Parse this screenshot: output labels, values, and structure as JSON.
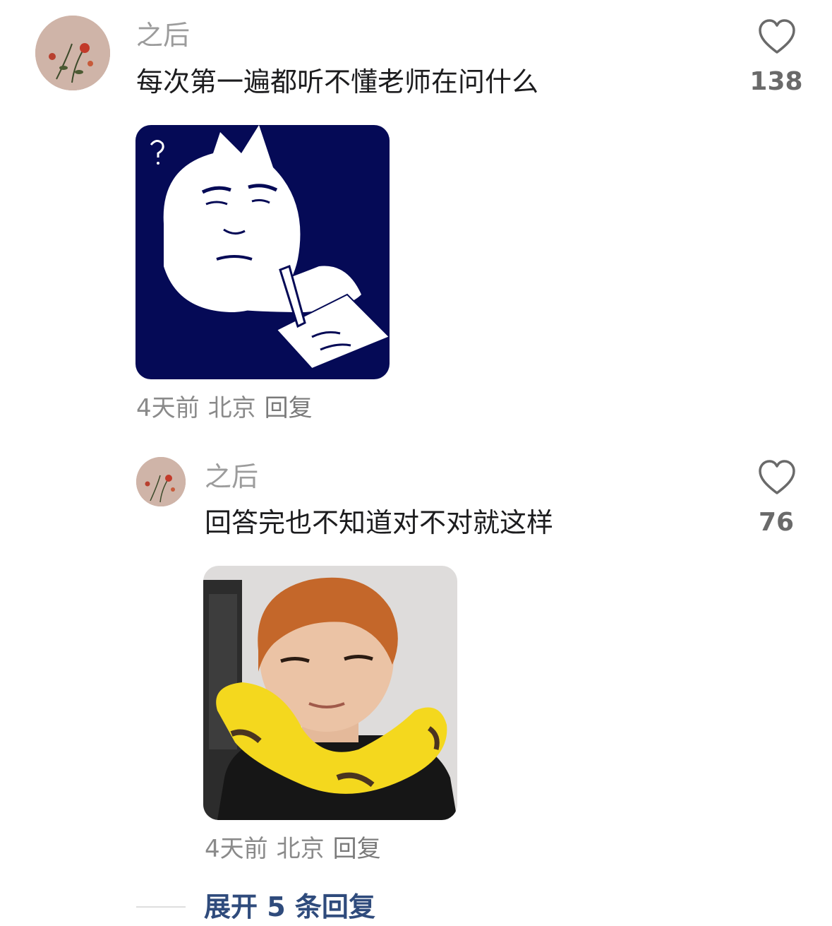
{
  "comments": [
    {
      "username": "之后",
      "text": "每次第一遍都听不懂老师在问什么",
      "likes": "138",
      "meta": {
        "time": "4天前",
        "location": "北京",
        "reply": "回复"
      },
      "sticker": "cartoon-cat-writing"
    },
    {
      "username": "之后",
      "text": "回答完也不知道对不对就这样",
      "likes": "76",
      "meta": {
        "time": "4天前",
        "location": "北京",
        "reply": "回复"
      },
      "sticker": "person-with-yellow-neck-pillow"
    }
  ],
  "expand_replies": "展开 5 条回复",
  "colors": {
    "username": "#9c9c9c",
    "expand_link": "#2f4b7c",
    "sticker1_bg": "#050a56"
  }
}
